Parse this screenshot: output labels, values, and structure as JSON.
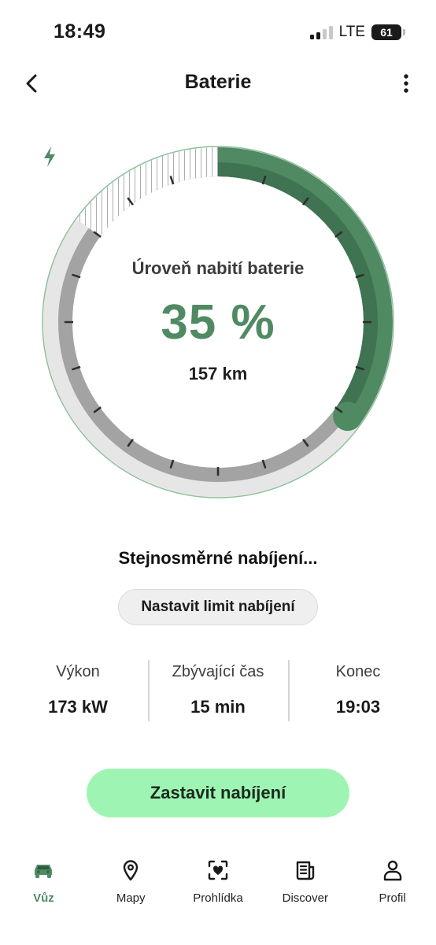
{
  "status_bar": {
    "time": "18:49",
    "network": "LTE",
    "battery_level": "61"
  },
  "header": {
    "title": "Baterie",
    "back_icon": "chevron-left-icon",
    "more_icon": "more-vertical-icon"
  },
  "gauge": {
    "label": "Úroveň nabití baterie",
    "value": "35 %",
    "percent": 35,
    "limit_percent": 85,
    "range": "157 km",
    "charging_icon": "lightning-bolt-icon",
    "colors": {
      "charge": "#4f8a63",
      "hatched": "#bdbdbd",
      "track": "#e6e6e6",
      "outline": "#8fbf9c"
    }
  },
  "charging": {
    "status": "Stejnosměrné nabíjení...",
    "limit_button": "Nastavit limit nabíjení"
  },
  "stats": [
    {
      "label": "Výkon",
      "value": "173 kW"
    },
    {
      "label": "Zbývající čas",
      "value": "15 min"
    },
    {
      "label": "Konec",
      "value": "19:03"
    }
  ],
  "stop_button": "Zastavit nabíjení",
  "nav": [
    {
      "label": "Vůz",
      "icon": "car-icon",
      "active": true
    },
    {
      "label": "Mapy",
      "icon": "map-pin-icon",
      "active": false
    },
    {
      "label": "Prohlídka",
      "icon": "inspection-heart-icon",
      "active": false
    },
    {
      "label": "Discover",
      "icon": "news-icon",
      "active": false
    },
    {
      "label": "Profil",
      "icon": "person-icon",
      "active": false
    }
  ],
  "accent_color": "#4f8a63",
  "button_color": "#9ef5b3"
}
